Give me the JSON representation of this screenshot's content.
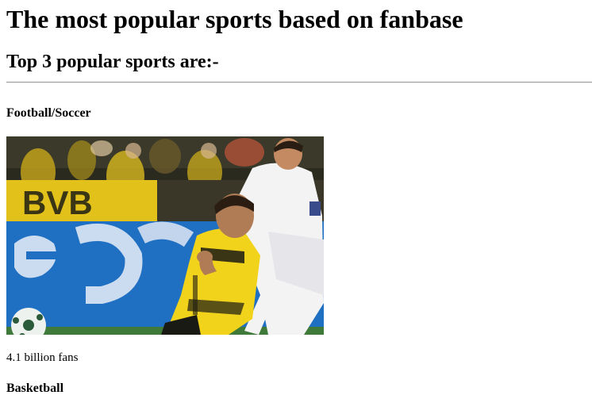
{
  "page": {
    "title": "The most popular sports based on fanbase",
    "subtitle": "Top 3 popular sports are:-"
  },
  "sports": [
    {
      "name": "Football/Soccer",
      "fans": "4.1 billion fans",
      "image": "football-match-photo"
    },
    {
      "name": "Basketball"
    }
  ],
  "colors": {
    "stadium_banner_blue": "#1f6fc2",
    "dortmund_yellow": "#f2d31b",
    "real_madrid_white": "#f3f3f3",
    "crowd_dark": "#2a2a1e",
    "pitch_green": "#3f7a3a"
  }
}
